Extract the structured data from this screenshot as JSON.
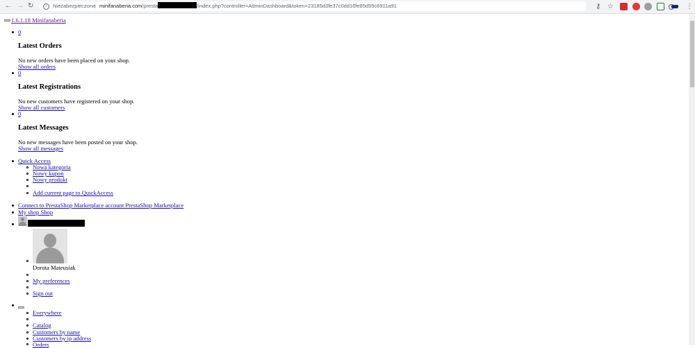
{
  "browser": {
    "security_label": "Niezabezpieczona",
    "url_host": "minifanaberia.com",
    "url_path_start": "/presta",
    "url_path_end": "/index.php?controller=AdminDashboard&token=23185d3fe37c0dd16fe85d55c6911a91"
  },
  "header": {
    "version_shop": "1.6.1.18 Minifanaberia"
  },
  "notifications": {
    "orders": {
      "count": "0",
      "title": "Latest Orders",
      "message": "No new orders have been placed on your shop.",
      "link": "Show all orders"
    },
    "registrations": {
      "count": "0",
      "title": "Latest Registrations",
      "message": "No new customers have registered on your shop.",
      "link": "Show all customers"
    },
    "messages": {
      "count": "0",
      "title": "Latest Messages",
      "message": "No new messages have been posted on your shop.",
      "link": "Show all messages"
    }
  },
  "quick_access": {
    "label": "Quick Access",
    "items": [
      "Nowa kategoria",
      "Nowy kupon",
      "Nowy produkt"
    ],
    "add_label": "Add current page to QuickAccess"
  },
  "marketplace": {
    "label": "Connect to PrestaShop Marketplace account PrestaShop Marketplace"
  },
  "my_shop": {
    "label": "My shop Shop"
  },
  "employee": {
    "name": "Dorota Mateusiak",
    "preferences": "My preferences",
    "sign_out": "Sign out"
  },
  "search": {
    "scope": "Everywhere",
    "options": [
      "Catalog",
      "Customers by name",
      "Customers by ip address",
      "Orders"
    ]
  }
}
